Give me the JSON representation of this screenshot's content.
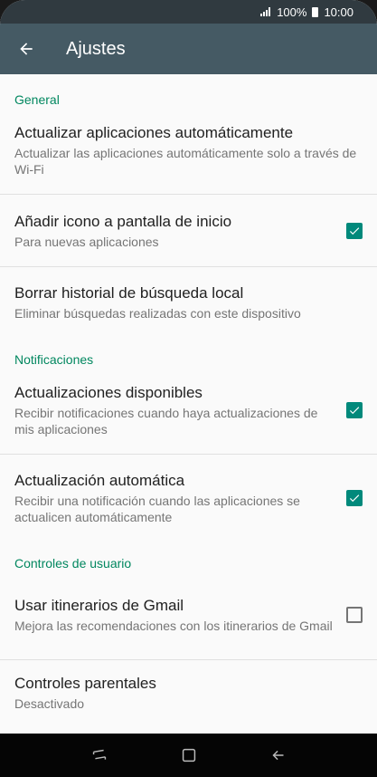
{
  "status_bar": {
    "battery_text": "100%",
    "time": "10:00"
  },
  "app_bar": {
    "title": "Ajustes",
    "back_icon": "arrow-back-icon"
  },
  "sections": {
    "general": {
      "header": "General",
      "items": [
        {
          "title": "Actualizar aplicaciones automáticamente",
          "subtitle": "Actualizar las aplicaciones automáticamente solo a través de Wi-Fi"
        },
        {
          "title": "Añadir icono a pantalla de inicio",
          "subtitle": "Para nuevas aplicaciones",
          "checked": true
        },
        {
          "title": "Borrar historial de búsqueda local",
          "subtitle": "Eliminar búsquedas realizadas con este dispositivo"
        }
      ]
    },
    "notifications": {
      "header": "Notificaciones",
      "items": [
        {
          "title": "Actualizaciones disponibles",
          "subtitle": "Recibir notificaciones cuando haya actualizaciones de mis aplicaciones",
          "checked": true
        },
        {
          "title": "Actualización automática",
          "subtitle": "Recibir una notificación cuando las aplicaciones se actualicen automáticamente",
          "checked": true
        }
      ]
    },
    "user_controls": {
      "header": "Controles de usuario",
      "items": [
        {
          "title": "Usar itinerarios de Gmail",
          "subtitle": "Mejora las recomendaciones con los itinerarios de Gmail",
          "checked": false
        },
        {
          "title": "Controles parentales",
          "subtitle": "Desactivado"
        }
      ]
    }
  },
  "colors": {
    "accent": "#01875f",
    "checkbox": "#00897b",
    "app_bar": "#455a64",
    "status_bar": "#303a40"
  }
}
